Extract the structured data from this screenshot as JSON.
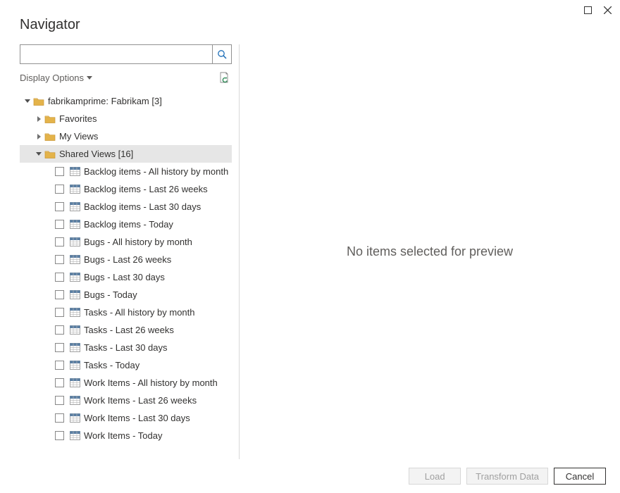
{
  "window": {
    "title": "Navigator",
    "controls": {
      "expand": "Expand",
      "close": "Close"
    }
  },
  "sidebar": {
    "search": {
      "placeholder": "",
      "value": ""
    },
    "display_options_label": "Display Options",
    "refresh_tooltip": "Refresh"
  },
  "tree": {
    "root": {
      "label": "fabrikamprime: Fabrikam [3]",
      "expanded": true
    },
    "root_children": [
      {
        "label": "Favorites",
        "expanded": false
      },
      {
        "label": "My Views",
        "expanded": false
      },
      {
        "label": "Shared Views [16]",
        "expanded": true,
        "selected": true
      }
    ],
    "shared_views_items": [
      {
        "label": "Backlog items - All history by month"
      },
      {
        "label": "Backlog items - Last 26 weeks"
      },
      {
        "label": "Backlog items - Last 30 days"
      },
      {
        "label": "Backlog items - Today"
      },
      {
        "label": "Bugs - All history by month"
      },
      {
        "label": "Bugs - Last 26 weeks"
      },
      {
        "label": "Bugs - Last 30 days"
      },
      {
        "label": "Bugs - Today"
      },
      {
        "label": "Tasks - All history by month"
      },
      {
        "label": "Tasks - Last 26 weeks"
      },
      {
        "label": "Tasks - Last 30 days"
      },
      {
        "label": "Tasks - Today"
      },
      {
        "label": "Work Items - All history by month"
      },
      {
        "label": "Work Items - Last 26 weeks"
      },
      {
        "label": "Work Items - Last 30 days"
      },
      {
        "label": "Work Items - Today"
      }
    ]
  },
  "preview": {
    "empty_text": "No items selected for preview"
  },
  "footer": {
    "load": "Load",
    "transform": "Transform Data",
    "cancel": "Cancel"
  },
  "colors": {
    "folder": "#e4b34a",
    "folder_outline": "#c99635",
    "table_header": "#5b7fa3",
    "accent_green": "#2e8b57"
  }
}
